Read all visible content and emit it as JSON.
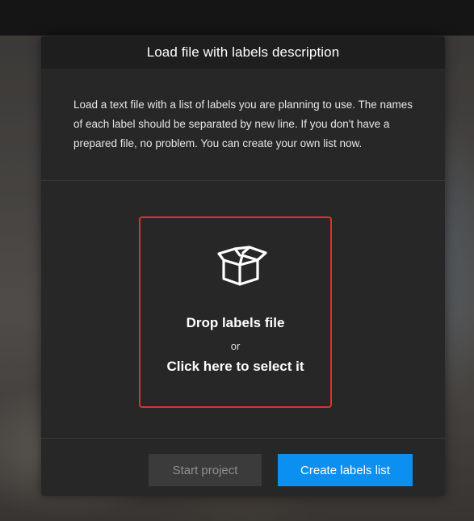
{
  "modal": {
    "title": "Load file with labels description",
    "description": "Load a text file with a list of labels you are planning to use. The names of each label should be separated by new line. If you don't have a prepared file, no problem. You can create your own list now."
  },
  "drop_zone": {
    "icon": "box-open-icon",
    "title": "Drop labels file",
    "separator": "or",
    "select_text": "Click here to select it",
    "border_color": "#e0302c"
  },
  "footer": {
    "start_label": "Start project",
    "create_label": "Create labels list",
    "create_color": "#0b8ff0"
  }
}
